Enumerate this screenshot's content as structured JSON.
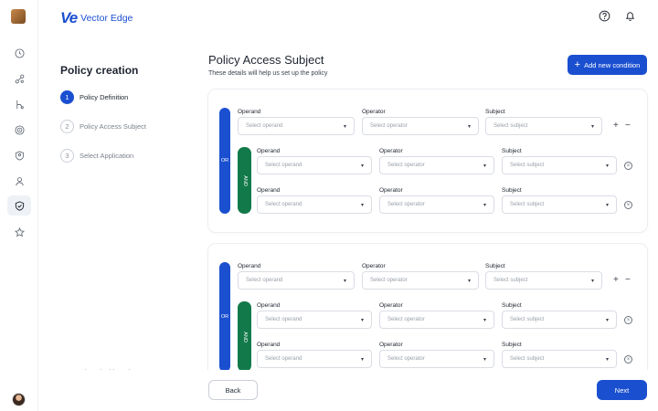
{
  "brand": {
    "mark": "Ve",
    "name": "Vector Edge"
  },
  "header_icons": [
    "help-icon",
    "bell-icon"
  ],
  "rail": {
    "icons": [
      "clock-icon",
      "nodes-icon",
      "branch-icon",
      "target-icon",
      "shield-user-icon",
      "user-icon",
      "shield-check-icon",
      "star-icon"
    ],
    "active": "shield-check-icon"
  },
  "sidebar": {
    "title": "Policy creation",
    "steps": [
      {
        "num": "1",
        "label": "Policy Definition"
      },
      {
        "num": "2",
        "label": "Policy Access Subject"
      },
      {
        "num": "3",
        "label": "Select Application"
      }
    ],
    "back": "Back to dashboard"
  },
  "main": {
    "title": "Policy Access Subject",
    "subtitle": "These details will help us set up the policy",
    "add_button": "Add new condition"
  },
  "labels": {
    "operand": "Operand",
    "operator": "Operator",
    "subject": "Subject",
    "or": "OR",
    "and": "AND",
    "plus": "+",
    "minus": "−",
    "remove": "×"
  },
  "placeholders": {
    "operand": "Select operand",
    "operator": "Select operator",
    "subject": "Select subject"
  },
  "footer": {
    "back": "Back",
    "next": "Next"
  },
  "colors": {
    "primary": "#1a4fd0",
    "and_green": "#127a4a"
  }
}
